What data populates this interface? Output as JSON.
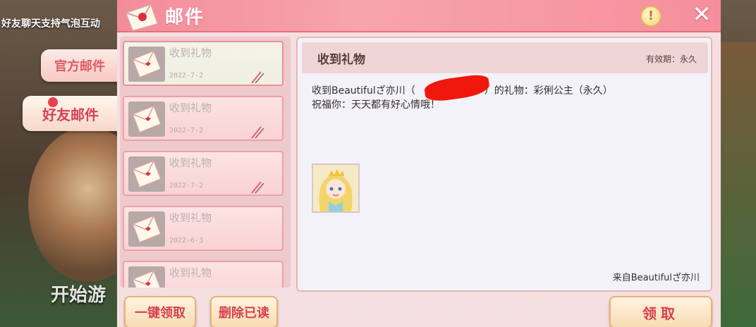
{
  "background": {
    "banner_text": "好友聊天支持气泡互动",
    "start_text": "开始游"
  },
  "tabs": [
    {
      "label": "官方邮件",
      "selected": false
    },
    {
      "label": "好友邮件",
      "selected": true,
      "has_notification": true
    }
  ],
  "window": {
    "title": "邮件",
    "info_icon": "info-icon",
    "info_glyph": "!",
    "close_icon": "close-icon",
    "close_glyph": "✕"
  },
  "mails": [
    {
      "title": "收到礼物",
      "date": "2022-7-2",
      "selected": true
    },
    {
      "title": "收到礼物",
      "date": "2022-7-2",
      "selected": false
    },
    {
      "title": "收到礼物",
      "date": "2022-7-2",
      "selected": false
    },
    {
      "title": "收到礼物",
      "date": "2022-6-3",
      "selected": false
    },
    {
      "title": "收到礼物",
      "date": "",
      "selected": false
    }
  ],
  "detail": {
    "title": "收到礼物",
    "validity": "有效期：永久",
    "line1": "收到Beautifulざ亦川（　　　　　　　）的礼物：彩俐公主（永久）",
    "line2": "祝福你：天天都有好心情哦！",
    "sender": "来自Beautifulざ亦川"
  },
  "buttons": {
    "claim_all": "一键领取",
    "delete_read": "删除已读",
    "claim": "领取"
  },
  "colors": {
    "title_bar": "#f38c99",
    "accent_text": "#d8404e",
    "button_bg": "#f9dcb4"
  }
}
